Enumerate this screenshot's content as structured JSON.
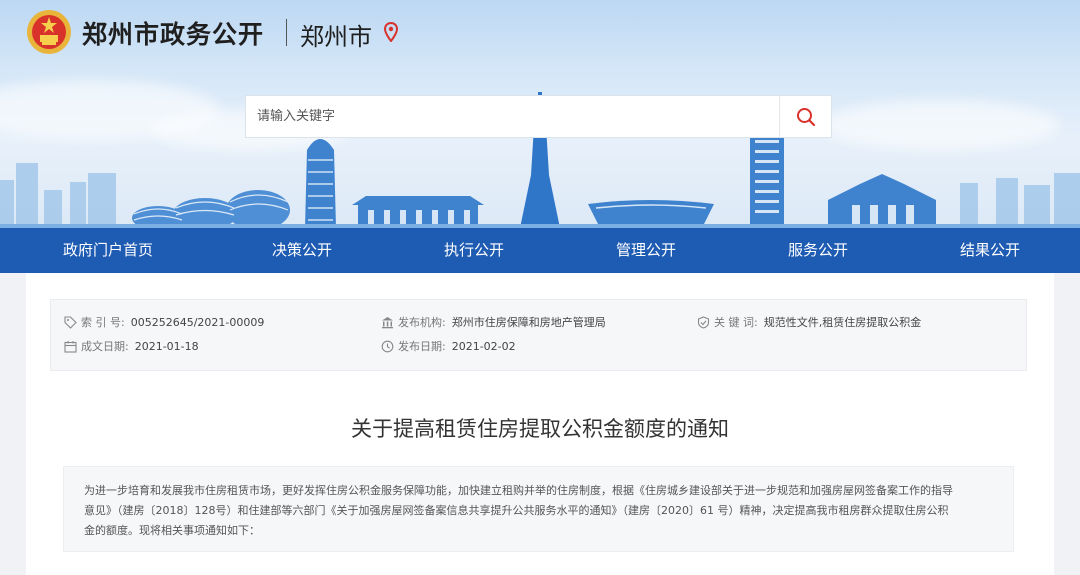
{
  "header": {
    "site_title": "郑州市政务公开",
    "city": "郑州市"
  },
  "search": {
    "placeholder": "请输入关键字"
  },
  "nav": {
    "items": [
      "政府门户首页",
      "决策公开",
      "执行公开",
      "管理公开",
      "服务公开",
      "结果公开"
    ]
  },
  "meta": {
    "index_label": "索 引 号:",
    "index_value": "005252645/2021-00009",
    "issuer_label": "发布机构:",
    "issuer_value": "郑州市住房保障和房地产管理局",
    "keywords_label": "关 键 词:",
    "keywords_value": "规范性文件,租赁住房提取公积金",
    "written_label": "成文日期:",
    "written_value": "2021-01-18",
    "published_label": "发布日期:",
    "published_value": "2021-02-02"
  },
  "document": {
    "title": "关于提高租赁住房提取公积金额度的通知",
    "body_lines": [
      "为进一步培育和发展我市住房租赁市场，更好发挥住房公积金服务保障功能，加快建立租购并举的住房制度，根据《住房城乡建设部关于进一步规范和加强房屋网签备案工作的指导",
      "意见》（建房〔2018〕128号）和住建部等六部门《关于加强房屋网签备案信息共享提升公共服务水平的通知》（建房〔2020〕61 号）精神，决定提高我市租房群众提取住房公积",
      "金的额度。现将相关事项通知如下："
    ]
  },
  "colors": {
    "nav_bg": "#1e5bb3",
    "accent_red": "#d9322b"
  },
  "icons": {
    "emblem": "national-emblem-icon",
    "location": "location-pin-icon",
    "search": "search-icon",
    "tag": "tag-icon",
    "institution": "institution-icon",
    "keywords": "keyword-shield-icon",
    "calendar": "calendar-icon",
    "clock": "clock-icon"
  }
}
